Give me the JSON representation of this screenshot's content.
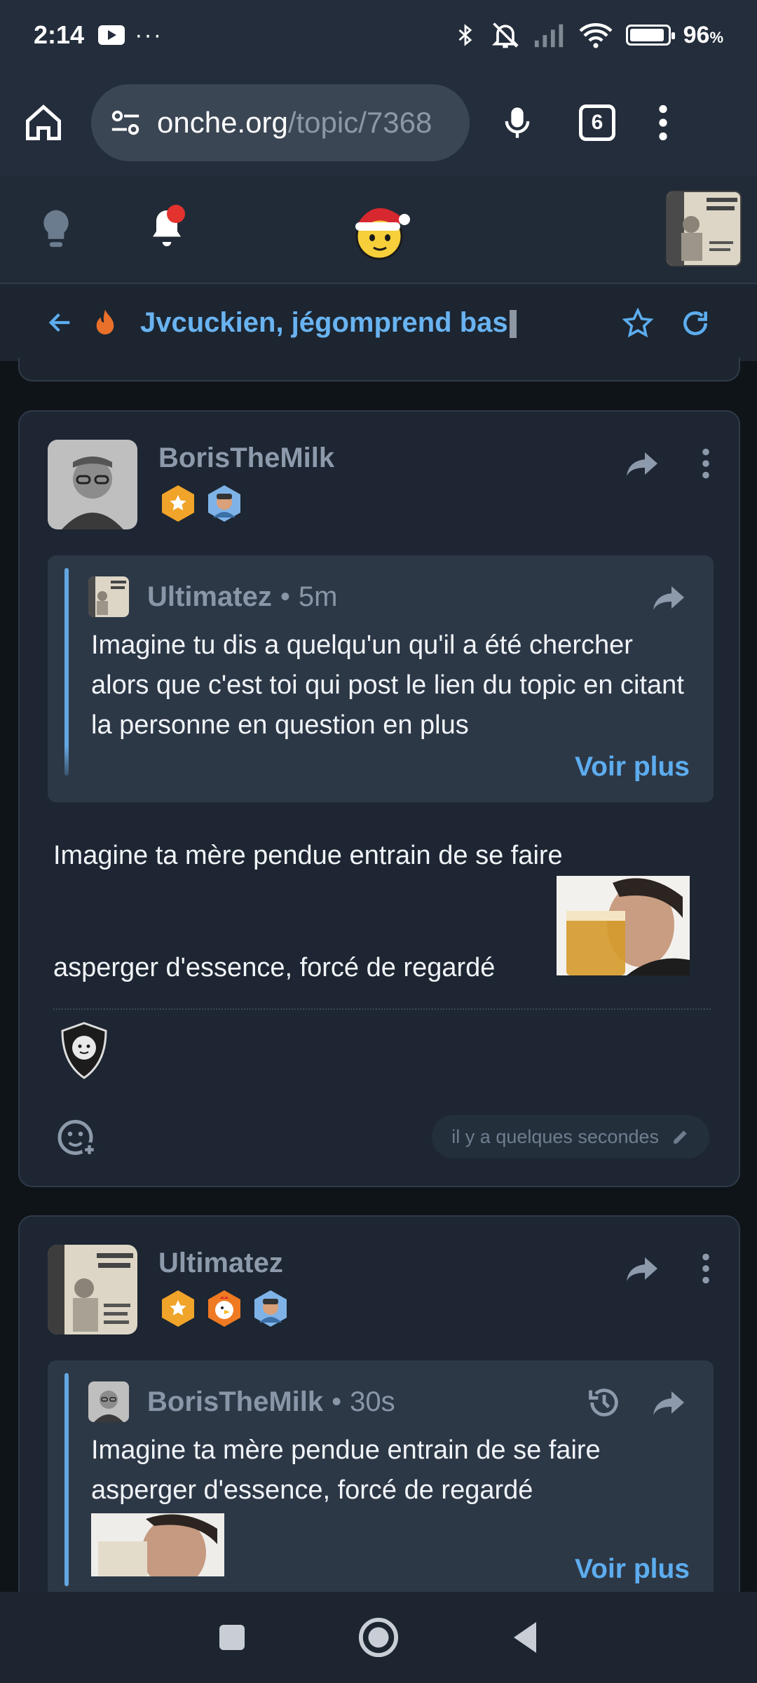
{
  "status_bar": {
    "time": "2:14",
    "more": "···",
    "battery": "96",
    "battery_unit": "%"
  },
  "browser": {
    "url_host": "onche.org",
    "url_path": "/topic/7368",
    "tab_count": "6"
  },
  "topic": {
    "title": "Jvcuckien, jégomprend bas"
  },
  "posts": [
    {
      "author": "BorisTheMilk",
      "quote": {
        "author": "Ultimatez",
        "separator": "•",
        "time": "5m",
        "text": "Imagine tu dis a quelqu'un qu'il a été chercher alors que c'est toi qui post le lien du topic en citant la personne en question en plus",
        "more_label": "Voir plus"
      },
      "body_line1": "Imagine ta mère pendue entrain de se faire",
      "body_line2": "asperger d'essence, forcé de regardé",
      "timestamp": "il y a quelques secondes"
    },
    {
      "author": "Ultimatez",
      "quote": {
        "author": "BorisTheMilk",
        "separator": "•",
        "time": "30s",
        "text": "Imagine ta mère pendue entrain de se faire asperger d'essence, forcé de regardé",
        "more_label": "Voir plus"
      }
    }
  ],
  "colors": {
    "accent": "#5dadef",
    "background": "#0f1419",
    "card": "#1d2632",
    "quote_bg": "#2d3847"
  }
}
